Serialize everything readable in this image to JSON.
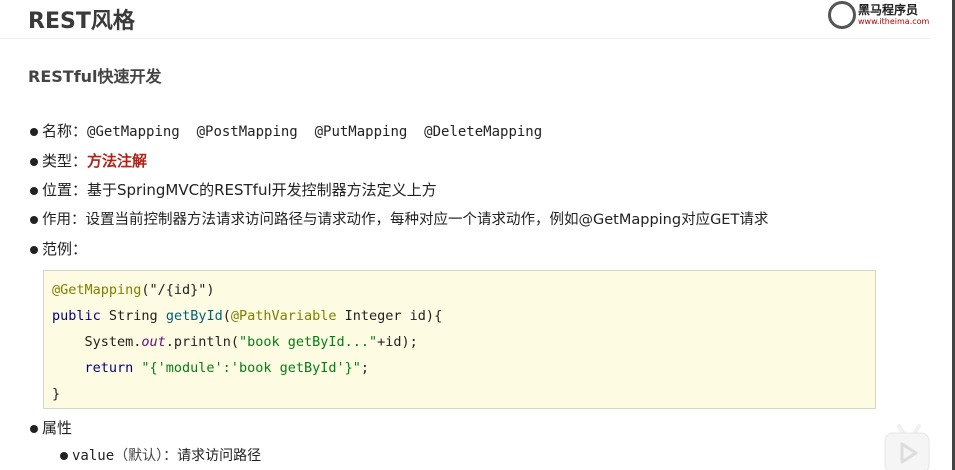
{
  "header": {
    "title": "REST风格",
    "logo_text": "黑马程序员",
    "logo_url": "www.itheima.com"
  },
  "subtitle": "RESTful快速开发",
  "bullets": [
    {
      "label": "名称：",
      "value": "@GetMapping  @PostMapping  @PutMapping  @DeleteMapping"
    },
    {
      "label": "类型：",
      "value": "方法注解"
    },
    {
      "label": "位置：",
      "value": "基于SpringMVC的RESTful开发控制器方法定义上方"
    },
    {
      "label": "作用：",
      "value": "设置当前控制器方法请求访问路径与请求动作，每种对应一个请求动作，例如@GetMapping对应GET请求"
    },
    {
      "label": "范例：",
      "value": ""
    }
  ],
  "code": {
    "l1_ann": "@GetMapping",
    "l1_rest": "(\"/{id}\")",
    "l2_kw": "public",
    "l2_type": " String ",
    "l2_fn": "getById",
    "l2_p": "(",
    "l2_ann": "@PathVariable",
    "l2_rest": " Integer id){",
    "l3_a": "    System.",
    "l3_out": "out",
    "l3_b": ".println(",
    "l3_str": "\"book getById...\"",
    "l3_c": "+id);",
    "l4_kw": "    return ",
    "l4_str": "\"{'module':'book getById'}\"",
    "l4_end": ";",
    "l5": "}"
  },
  "attributes": {
    "label": "属性",
    "items": [
      {
        "name": "value",
        "note": "（默认）：",
        "desc": "请求访问路径"
      }
    ]
  },
  "colors": {
    "accent": "#b02418",
    "code_bg": "#fdfbe2"
  }
}
